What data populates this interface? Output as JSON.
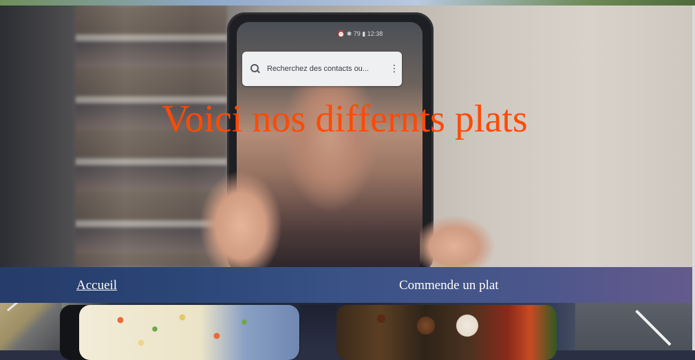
{
  "hero": {
    "title": "Voici nos differnts plats",
    "phone_search_placeholder": "Recherchez des contacts ou...",
    "phone_status": "⏰ ✱ 79 ▮ 12:38"
  },
  "nav": {
    "home_label": "Accueil",
    "order_label": "Commende un plat"
  },
  "colors": {
    "title": "#ff4a05",
    "nav_text": "#ffffff",
    "nav_bg_start": "#263c6a",
    "nav_bg_end": "#655a8c"
  },
  "icons": {
    "phone_search": "search-icon",
    "phone_menu": "more-vertical-icon"
  }
}
